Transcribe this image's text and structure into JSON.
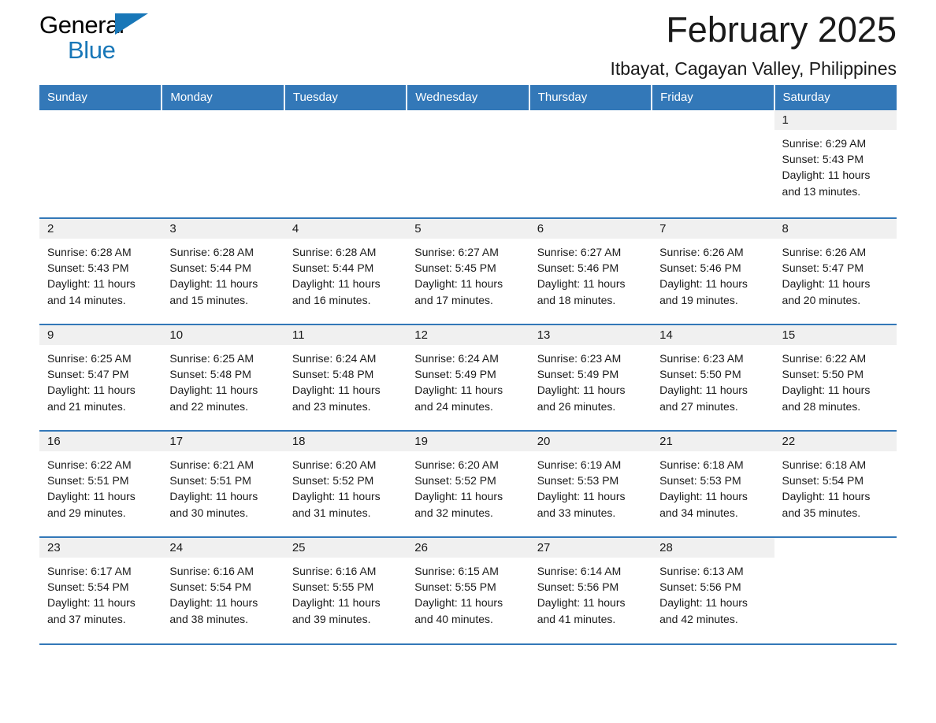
{
  "brand": {
    "name_part1": "General",
    "name_part2": "Blue"
  },
  "header": {
    "title": "February 2025",
    "location": "Itbayat, Cagayan Valley, Philippines"
  },
  "calendar": {
    "weekdays": [
      "Sunday",
      "Monday",
      "Tuesday",
      "Wednesday",
      "Thursday",
      "Friday",
      "Saturday"
    ],
    "accent_color": "#3378b8",
    "daynum_band_color": "#f0f0f0",
    "weeks": [
      [
        {
          "day": "",
          "sunrise": "",
          "sunset": "",
          "daylight_line1": "",
          "daylight_line2": ""
        },
        {
          "day": "",
          "sunrise": "",
          "sunset": "",
          "daylight_line1": "",
          "daylight_line2": ""
        },
        {
          "day": "",
          "sunrise": "",
          "sunset": "",
          "daylight_line1": "",
          "daylight_line2": ""
        },
        {
          "day": "",
          "sunrise": "",
          "sunset": "",
          "daylight_line1": "",
          "daylight_line2": ""
        },
        {
          "day": "",
          "sunrise": "",
          "sunset": "",
          "daylight_line1": "",
          "daylight_line2": ""
        },
        {
          "day": "",
          "sunrise": "",
          "sunset": "",
          "daylight_line1": "",
          "daylight_line2": ""
        },
        {
          "day": "1",
          "sunrise": "Sunrise: 6:29 AM",
          "sunset": "Sunset: 5:43 PM",
          "daylight_line1": "Daylight: 11 hours",
          "daylight_line2": "and 13 minutes."
        }
      ],
      [
        {
          "day": "2",
          "sunrise": "Sunrise: 6:28 AM",
          "sunset": "Sunset: 5:43 PM",
          "daylight_line1": "Daylight: 11 hours",
          "daylight_line2": "and 14 minutes."
        },
        {
          "day": "3",
          "sunrise": "Sunrise: 6:28 AM",
          "sunset": "Sunset: 5:44 PM",
          "daylight_line1": "Daylight: 11 hours",
          "daylight_line2": "and 15 minutes."
        },
        {
          "day": "4",
          "sunrise": "Sunrise: 6:28 AM",
          "sunset": "Sunset: 5:44 PM",
          "daylight_line1": "Daylight: 11 hours",
          "daylight_line2": "and 16 minutes."
        },
        {
          "day": "5",
          "sunrise": "Sunrise: 6:27 AM",
          "sunset": "Sunset: 5:45 PM",
          "daylight_line1": "Daylight: 11 hours",
          "daylight_line2": "and 17 minutes."
        },
        {
          "day": "6",
          "sunrise": "Sunrise: 6:27 AM",
          "sunset": "Sunset: 5:46 PM",
          "daylight_line1": "Daylight: 11 hours",
          "daylight_line2": "and 18 minutes."
        },
        {
          "day": "7",
          "sunrise": "Sunrise: 6:26 AM",
          "sunset": "Sunset: 5:46 PM",
          "daylight_line1": "Daylight: 11 hours",
          "daylight_line2": "and 19 minutes."
        },
        {
          "day": "8",
          "sunrise": "Sunrise: 6:26 AM",
          "sunset": "Sunset: 5:47 PM",
          "daylight_line1": "Daylight: 11 hours",
          "daylight_line2": "and 20 minutes."
        }
      ],
      [
        {
          "day": "9",
          "sunrise": "Sunrise: 6:25 AM",
          "sunset": "Sunset: 5:47 PM",
          "daylight_line1": "Daylight: 11 hours",
          "daylight_line2": "and 21 minutes."
        },
        {
          "day": "10",
          "sunrise": "Sunrise: 6:25 AM",
          "sunset": "Sunset: 5:48 PM",
          "daylight_line1": "Daylight: 11 hours",
          "daylight_line2": "and 22 minutes."
        },
        {
          "day": "11",
          "sunrise": "Sunrise: 6:24 AM",
          "sunset": "Sunset: 5:48 PM",
          "daylight_line1": "Daylight: 11 hours",
          "daylight_line2": "and 23 minutes."
        },
        {
          "day": "12",
          "sunrise": "Sunrise: 6:24 AM",
          "sunset": "Sunset: 5:49 PM",
          "daylight_line1": "Daylight: 11 hours",
          "daylight_line2": "and 24 minutes."
        },
        {
          "day": "13",
          "sunrise": "Sunrise: 6:23 AM",
          "sunset": "Sunset: 5:49 PM",
          "daylight_line1": "Daylight: 11 hours",
          "daylight_line2": "and 26 minutes."
        },
        {
          "day": "14",
          "sunrise": "Sunrise: 6:23 AM",
          "sunset": "Sunset: 5:50 PM",
          "daylight_line1": "Daylight: 11 hours",
          "daylight_line2": "and 27 minutes."
        },
        {
          "day": "15",
          "sunrise": "Sunrise: 6:22 AM",
          "sunset": "Sunset: 5:50 PM",
          "daylight_line1": "Daylight: 11 hours",
          "daylight_line2": "and 28 minutes."
        }
      ],
      [
        {
          "day": "16",
          "sunrise": "Sunrise: 6:22 AM",
          "sunset": "Sunset: 5:51 PM",
          "daylight_line1": "Daylight: 11 hours",
          "daylight_line2": "and 29 minutes."
        },
        {
          "day": "17",
          "sunrise": "Sunrise: 6:21 AM",
          "sunset": "Sunset: 5:51 PM",
          "daylight_line1": "Daylight: 11 hours",
          "daylight_line2": "and 30 minutes."
        },
        {
          "day": "18",
          "sunrise": "Sunrise: 6:20 AM",
          "sunset": "Sunset: 5:52 PM",
          "daylight_line1": "Daylight: 11 hours",
          "daylight_line2": "and 31 minutes."
        },
        {
          "day": "19",
          "sunrise": "Sunrise: 6:20 AM",
          "sunset": "Sunset: 5:52 PM",
          "daylight_line1": "Daylight: 11 hours",
          "daylight_line2": "and 32 minutes."
        },
        {
          "day": "20",
          "sunrise": "Sunrise: 6:19 AM",
          "sunset": "Sunset: 5:53 PM",
          "daylight_line1": "Daylight: 11 hours",
          "daylight_line2": "and 33 minutes."
        },
        {
          "day": "21",
          "sunrise": "Sunrise: 6:18 AM",
          "sunset": "Sunset: 5:53 PM",
          "daylight_line1": "Daylight: 11 hours",
          "daylight_line2": "and 34 minutes."
        },
        {
          "day": "22",
          "sunrise": "Sunrise: 6:18 AM",
          "sunset": "Sunset: 5:54 PM",
          "daylight_line1": "Daylight: 11 hours",
          "daylight_line2": "and 35 minutes."
        }
      ],
      [
        {
          "day": "23",
          "sunrise": "Sunrise: 6:17 AM",
          "sunset": "Sunset: 5:54 PM",
          "daylight_line1": "Daylight: 11 hours",
          "daylight_line2": "and 37 minutes."
        },
        {
          "day": "24",
          "sunrise": "Sunrise: 6:16 AM",
          "sunset": "Sunset: 5:54 PM",
          "daylight_line1": "Daylight: 11 hours",
          "daylight_line2": "and 38 minutes."
        },
        {
          "day": "25",
          "sunrise": "Sunrise: 6:16 AM",
          "sunset": "Sunset: 5:55 PM",
          "daylight_line1": "Daylight: 11 hours",
          "daylight_line2": "and 39 minutes."
        },
        {
          "day": "26",
          "sunrise": "Sunrise: 6:15 AM",
          "sunset": "Sunset: 5:55 PM",
          "daylight_line1": "Daylight: 11 hours",
          "daylight_line2": "and 40 minutes."
        },
        {
          "day": "27",
          "sunrise": "Sunrise: 6:14 AM",
          "sunset": "Sunset: 5:56 PM",
          "daylight_line1": "Daylight: 11 hours",
          "daylight_line2": "and 41 minutes."
        },
        {
          "day": "28",
          "sunrise": "Sunrise: 6:13 AM",
          "sunset": "Sunset: 5:56 PM",
          "daylight_line1": "Daylight: 11 hours",
          "daylight_line2": "and 42 minutes."
        },
        {
          "day": "",
          "sunrise": "",
          "sunset": "",
          "daylight_line1": "",
          "daylight_line2": ""
        }
      ]
    ]
  }
}
